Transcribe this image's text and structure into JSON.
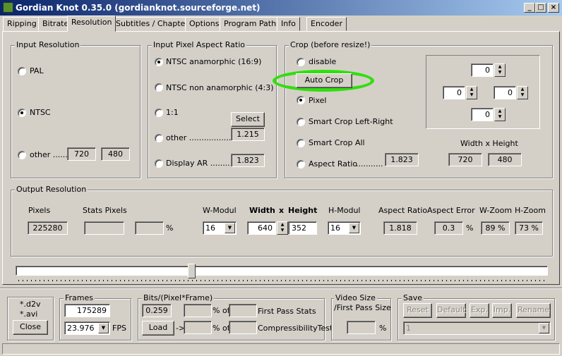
{
  "window": {
    "title": "Gordian Knot 0.35.0  (gordianknot.sourceforge.net)",
    "min_glyph": "_",
    "max_glyph": "□",
    "close_glyph": "×"
  },
  "tabs": [
    "Ripping",
    "Bitrate",
    "Resolution",
    "Subtitles / Chapters",
    "Options",
    "Program Paths",
    "Info",
    "Encoder"
  ],
  "input_resolution": {
    "legend": "Input Resolution",
    "pal": "PAL",
    "ntsc": "NTSC",
    "other": "other .......",
    "width": "720",
    "height": "480",
    "selected": "NTSC"
  },
  "aspect_ratio": {
    "legend": "Input Pixel Aspect Ratio",
    "ntsc_ana": "NTSC anamorphic (16:9)",
    "ntsc_non": "NTSC non anamorphic (4:3)",
    "one": "1:1",
    "other": "other .................",
    "display": "Display AR ........",
    "select_btn": "Select",
    "other_value": "1.215",
    "display_value": "1.823"
  },
  "crop": {
    "legend": "Crop (before resize!)",
    "disable": "disable",
    "auto_crop": "Auto Crop",
    "pixel": "Pixel",
    "smart_lr": "Smart Crop Left-Right",
    "smart_all": "Smart Crop All",
    "aspect": "Aspect Ratio",
    "aspect_dots": "...........",
    "aspect_value": "1.823",
    "top": "0",
    "left": "0",
    "right": "0",
    "bottom": "0",
    "wh_label": "Width x Height",
    "width": "720",
    "height": "480",
    "highlight_color": "#33dd11"
  },
  "output": {
    "legend": "Output Resolution",
    "pixels_label": "Pixels",
    "pixels": "225280",
    "stats_label": "Stats Pixels",
    "percent": "%",
    "wmodul_label": "W-Modul",
    "wmodul": "16",
    "width_label": "Width",
    "x_label": "x",
    "height_label": "Height",
    "width": "640",
    "height": "352",
    "hmodul_label": "H-Modul",
    "hmodul": "16",
    "ar_label": "Aspect Ratio",
    "ar": "1.818",
    "err_label": "Aspect Error",
    "err": "0.3",
    "wzoom_label": "W-Zoom",
    "wzoom": "89 %",
    "hzoom_label": "H-Zoom",
    "hzoom": "73 %"
  },
  "bottom": {
    "files": {
      "d2v": "*.d2v",
      "avi": "*.avi",
      "close": "Close"
    },
    "frames": {
      "legend": "Frames",
      "count": "175289",
      "fps": "23.976",
      "fps_label": "FPS"
    },
    "bpp": {
      "legend": "Bits/(Pixel*Frame)",
      "value": "0.259",
      "pct_of": "% of",
      "first_pass": "First Pass Stats",
      "load": "Load",
      "arrow": "->",
      "compress": "CompressibilityTest"
    },
    "video_size": {
      "line1": "Video Size",
      "line2": "/First Pass Size",
      "pct": "%"
    },
    "save": {
      "legend": "Save",
      "reset": "Reset",
      "default": "Default",
      "exp": "Exp.",
      "imp": "Imp.",
      "rename": "Rename",
      "slot": "1"
    }
  }
}
